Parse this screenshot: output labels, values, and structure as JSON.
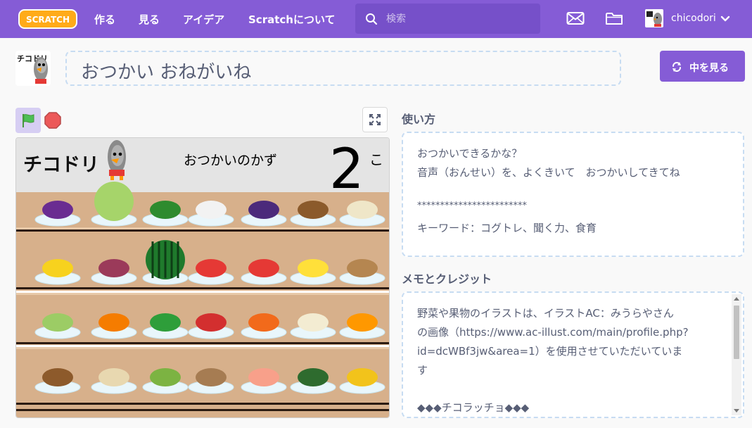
{
  "nav": {
    "logo_text": "SCRATCH",
    "links": [
      "作る",
      "見る",
      "アイデア",
      "Scratchについて"
    ],
    "search_placeholder": "検索",
    "username": "chicodori",
    "icons": [
      "messages-icon",
      "my-stuff-folder-icon",
      "chevron-down-icon"
    ],
    "color": "#855cd6"
  },
  "project": {
    "title": "おつかい おねがいね",
    "see_inside_label": "中を見る",
    "avatar_logo_text": "チコドリ"
  },
  "stage": {
    "logo_text": "チコドリ",
    "counter_label": "おつかいのかず",
    "counter_value": "2",
    "counter_unit": "こ",
    "items": [
      "grapes",
      "melon",
      "broccoli",
      "daikon",
      "eggplant",
      "mushrooms",
      "onions",
      "bananas",
      "sweet-potato",
      "watermelon",
      "strawberries",
      "tomatoes",
      "lemon",
      "potatoes",
      "cabbage",
      "persimmons",
      "green-peppers",
      "apple",
      "carrots",
      "enoki",
      "oranges",
      "taro",
      "lotus-root",
      "green-onion",
      "shimeji",
      "peaches",
      "pumpkin",
      "corn"
    ]
  },
  "instructions": {
    "heading": "使い方",
    "lines": [
      "おつかいできるかな？",
      "音声（おんせい）を、よくきいて　おつかいしてきてね",
      "",
      "************************",
      "キーワード：コグトレ、聞く力、食育"
    ]
  },
  "notes": {
    "heading": "メモとクレジット",
    "lines": [
      "野菜や果物のイラストは、イラストAC：みうらやさん",
      "の画像（https://www.ac-illust.com/main/profile.php?",
      "id=dcWBf3jw&area=1）を使用させていただいていま",
      "す",
      "",
      "◆◆◆チコラッチョ◆◆◆"
    ]
  }
}
